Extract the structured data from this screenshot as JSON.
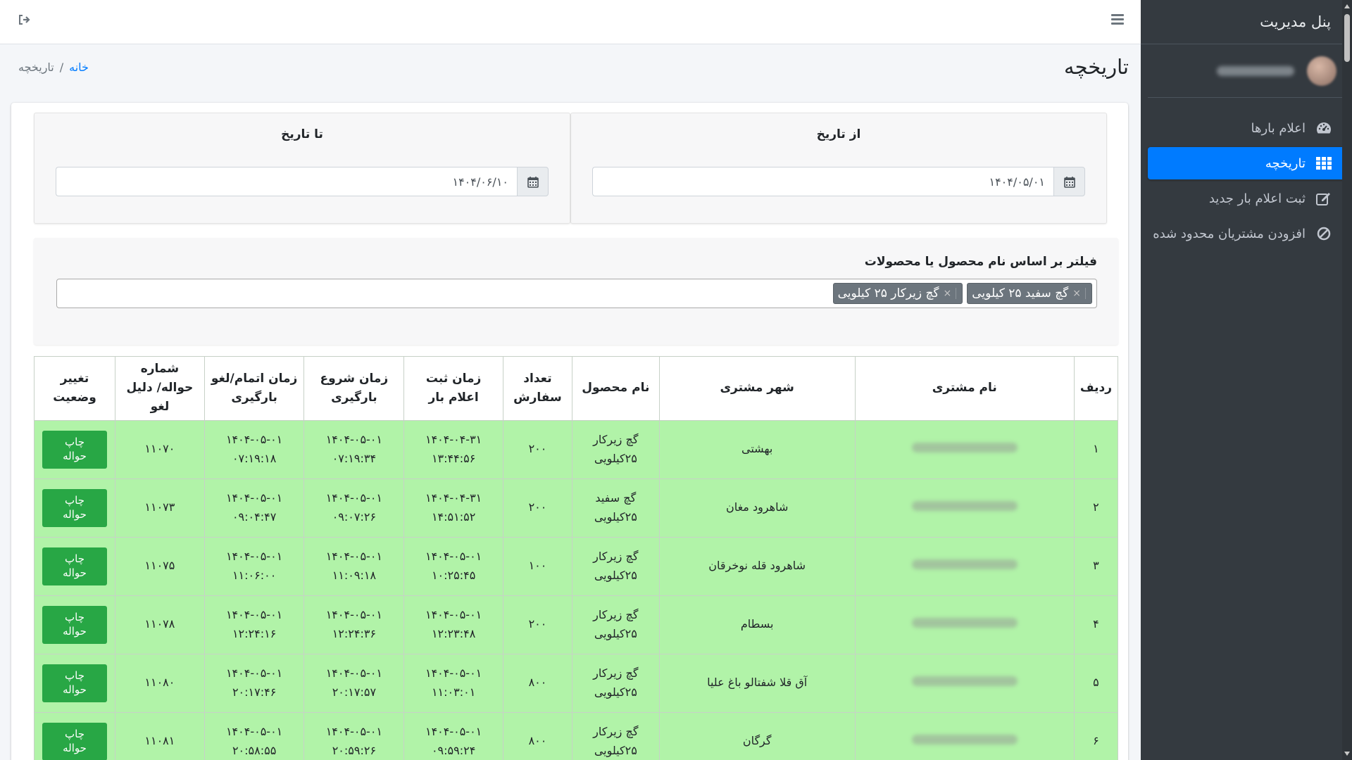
{
  "sidebar": {
    "brand": "پنل مدیریت",
    "items": [
      {
        "label": "اعلام بارها",
        "icon": "tachometer-icon"
      },
      {
        "label": "تاریخچه",
        "icon": "grid-icon",
        "active": true
      },
      {
        "label": "ثبت اعلام بار جدید",
        "icon": "edit-icon"
      },
      {
        "label": "افزودن مشتریان محدود شده",
        "icon": "ban-icon"
      }
    ]
  },
  "header": {
    "menu_icon": "hamburger-icon",
    "logout_icon": "sign-out-icon"
  },
  "page": {
    "title": "تاریخچه",
    "breadcrumb": {
      "home": "خانه",
      "separator": "/",
      "current": "تاریخچه"
    }
  },
  "date_filter": {
    "from_label": "از تاریخ",
    "from_value": "۱۴۰۴/۰۵/۰۱",
    "to_label": "تا تاریخ",
    "to_value": "۱۴۰۴/۰۶/۱۰"
  },
  "product_filter": {
    "label": "فیلتر بر اساس نام محصول یا محصولات",
    "tags": [
      "گچ سفید ۲۵ کیلویی",
      "گچ زیرکار ۲۵ کیلویی"
    ],
    "remove_symbol": "×"
  },
  "table": {
    "headers": [
      "ردیف",
      "نام مشتری",
      "شهر مشتری",
      "نام محصول",
      "تعداد سفارش",
      "زمان ثبت اعلام بار",
      "زمان شروع بارگیری",
      "زمان اتمام/لغو بارگیری",
      "شماره حواله/ دلیل لغو",
      "تغییر وضعیت"
    ],
    "action_label": [
      "چاپ",
      "حواله"
    ],
    "rows": [
      {
        "no": "۱",
        "city": "بهشتی",
        "product": [
          "گچ زیرکار",
          "۲۵کیلویی"
        ],
        "qty": "۲۰۰",
        "registered": [
          "۱۴۰۴-۰۴-۳۱",
          "۱۳:۴۴:۵۶"
        ],
        "start": [
          "۱۴۰۴-۰۵-۰۱",
          "۰۷:۱۹:۳۴"
        ],
        "end": [
          "۱۴۰۴-۰۵-۰۱",
          "۰۷:۱۹:۱۸"
        ],
        "ref": "۱۱۰۷۰"
      },
      {
        "no": "۲",
        "city": "شاهرود مغان",
        "product": [
          "گچ سفید",
          "۲۵کیلویی"
        ],
        "qty": "۲۰۰",
        "registered": [
          "۱۴۰۴-۰۴-۳۱",
          "۱۴:۵۱:۵۲"
        ],
        "start": [
          "۱۴۰۴-۰۵-۰۱",
          "۰۹:۰۷:۲۶"
        ],
        "end": [
          "۱۴۰۴-۰۵-۰۱",
          "۰۹:۰۴:۴۷"
        ],
        "ref": "۱۱۰۷۳"
      },
      {
        "no": "۳",
        "city": "شاهرود قله نوخرقان",
        "product": [
          "گچ زیرکار",
          "۲۵کیلویی"
        ],
        "qty": "۱۰۰",
        "registered": [
          "۱۴۰۴-۰۵-۰۱",
          "۱۰:۲۵:۴۵"
        ],
        "start": [
          "۱۴۰۴-۰۵-۰۱",
          "۱۱:۰۹:۱۸"
        ],
        "end": [
          "۱۴۰۴-۰۵-۰۱",
          "۱۱:۰۶:۰۰"
        ],
        "ref": "۱۱۰۷۵"
      },
      {
        "no": "۴",
        "city": "بسطام",
        "product": [
          "گچ زیرکار",
          "۲۵کیلویی"
        ],
        "qty": "۲۰۰",
        "registered": [
          "۱۴۰۴-۰۵-۰۱",
          "۱۲:۲۳:۴۸"
        ],
        "start": [
          "۱۴۰۴-۰۵-۰۱",
          "۱۲:۲۴:۳۶"
        ],
        "end": [
          "۱۴۰۴-۰۵-۰۱",
          "۱۲:۲۴:۱۶"
        ],
        "ref": "۱۱۰۷۸"
      },
      {
        "no": "۵",
        "city": "آق قلا شفتالو باغ علیا",
        "product": [
          "گچ زیرکار",
          "۲۵کیلویی"
        ],
        "qty": "۸۰۰",
        "registered": [
          "۱۴۰۴-۰۵-۰۱",
          "۱۱:۰۳:۰۱"
        ],
        "start": [
          "۱۴۰۴-۰۵-۰۱",
          "۲۰:۱۷:۵۷"
        ],
        "end": [
          "۱۴۰۴-۰۵-۰۱",
          "۲۰:۱۷:۴۶"
        ],
        "ref": "۱۱۰۸۰"
      },
      {
        "no": "۶",
        "city": "گرگان",
        "product": [
          "گچ زیرکار",
          "۲۵کیلویی"
        ],
        "qty": "۸۰۰",
        "registered": [
          "۱۴۰۴-۰۵-۰۱",
          "۰۹:۵۹:۲۴"
        ],
        "start": [
          "۱۴۰۴-۰۵-۰۱",
          "۲۰:۵۹:۲۶"
        ],
        "end": [
          "۱۴۰۴-۰۵-۰۱",
          "۲۰:۵۸:۵۵"
        ],
        "ref": "۱۱۰۸۱"
      }
    ]
  },
  "colors": {
    "sidebar_bg": "#343a40",
    "accent": "#007bff",
    "row_bg": "#b1f3a8",
    "button_green": "#28a745"
  }
}
